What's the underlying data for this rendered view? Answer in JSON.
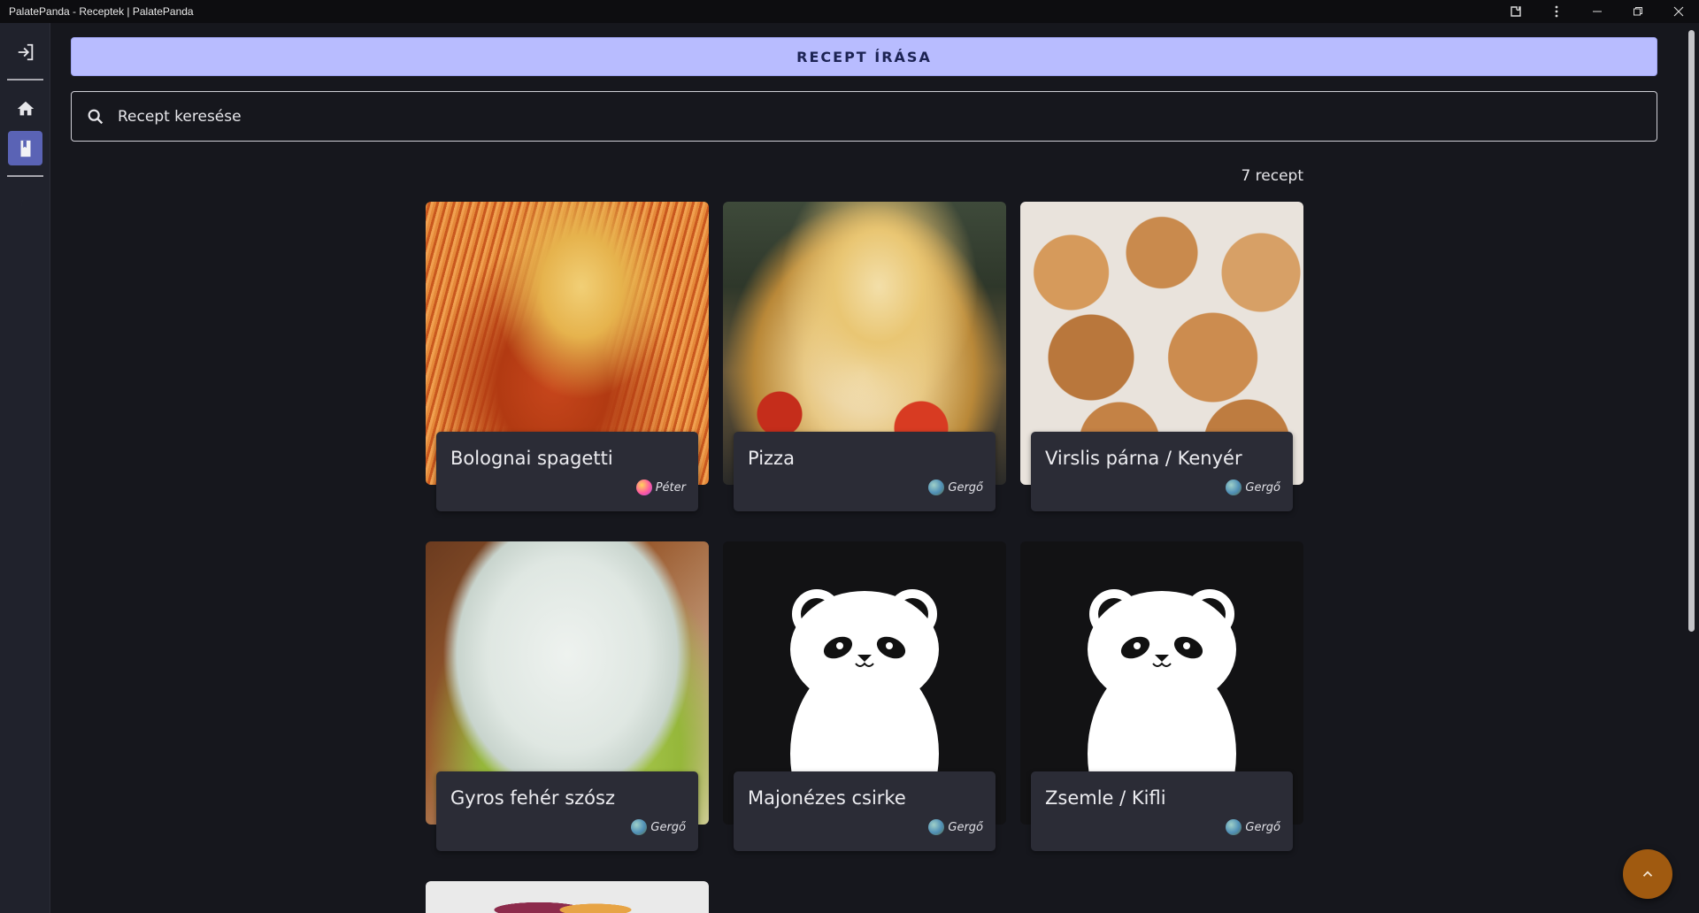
{
  "window": {
    "title": "PalatePanda - Receptek | PalatePanda"
  },
  "sidebar": {
    "items": [
      {
        "name": "login-icon"
      },
      {
        "name": "home-icon"
      },
      {
        "name": "recipes-icon",
        "active": true
      },
      {
        "name": "dark-mode-icon"
      }
    ]
  },
  "actions": {
    "write_label": "RECEPT ÍRÁSA"
  },
  "search": {
    "placeholder": "Recept keresése"
  },
  "results": {
    "count_label": "7 recept"
  },
  "recipes": [
    {
      "title": "Bolognai spagetti",
      "author": "Péter"
    },
    {
      "title": "Pizza",
      "author": "Gergő"
    },
    {
      "title": "Virslis párna / Kenyér",
      "author": "Gergő"
    },
    {
      "title": "Gyros fehér szósz",
      "author": "Gergő"
    },
    {
      "title": "Majonézes csirke",
      "author": "Gergő"
    },
    {
      "title": "Zsemle / Kifli",
      "author": "Gergő"
    }
  ],
  "colors": {
    "accent": "#b8bcff",
    "sidebar_active": "#5a63b5",
    "fab": "#a05a10",
    "card": "#2b2c36",
    "background": "#16171d"
  }
}
